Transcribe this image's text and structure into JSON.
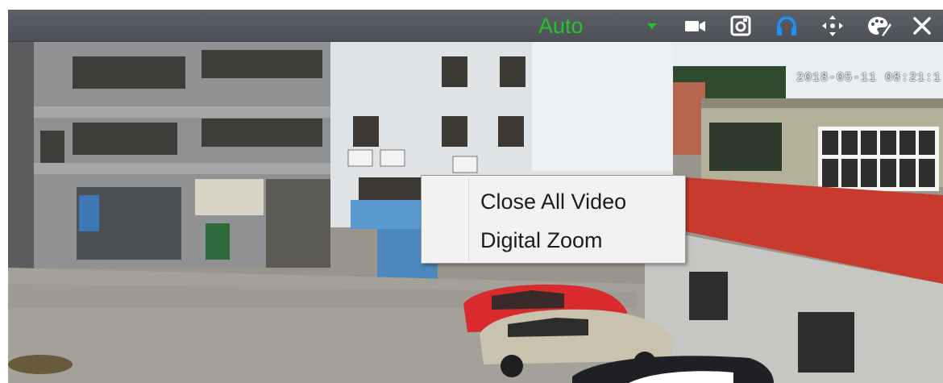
{
  "toolbar": {
    "stream_mode": "Auto",
    "stream_mode_color": "#22c42a",
    "icons": [
      "dropdown-arrow-icon",
      "record-video-icon",
      "snapshot-camera-icon",
      "audio-headphones-icon",
      "ptz-move-icon",
      "image-adjust-palette-icon",
      "close-icon"
    ],
    "headphones_color": "#1e90ff"
  },
  "video": {
    "osd_timestamp": "2018-05-11 08:21:1"
  },
  "context_menu": {
    "items": [
      {
        "label": "Close All Video"
      },
      {
        "label": "Digital Zoom"
      }
    ]
  }
}
